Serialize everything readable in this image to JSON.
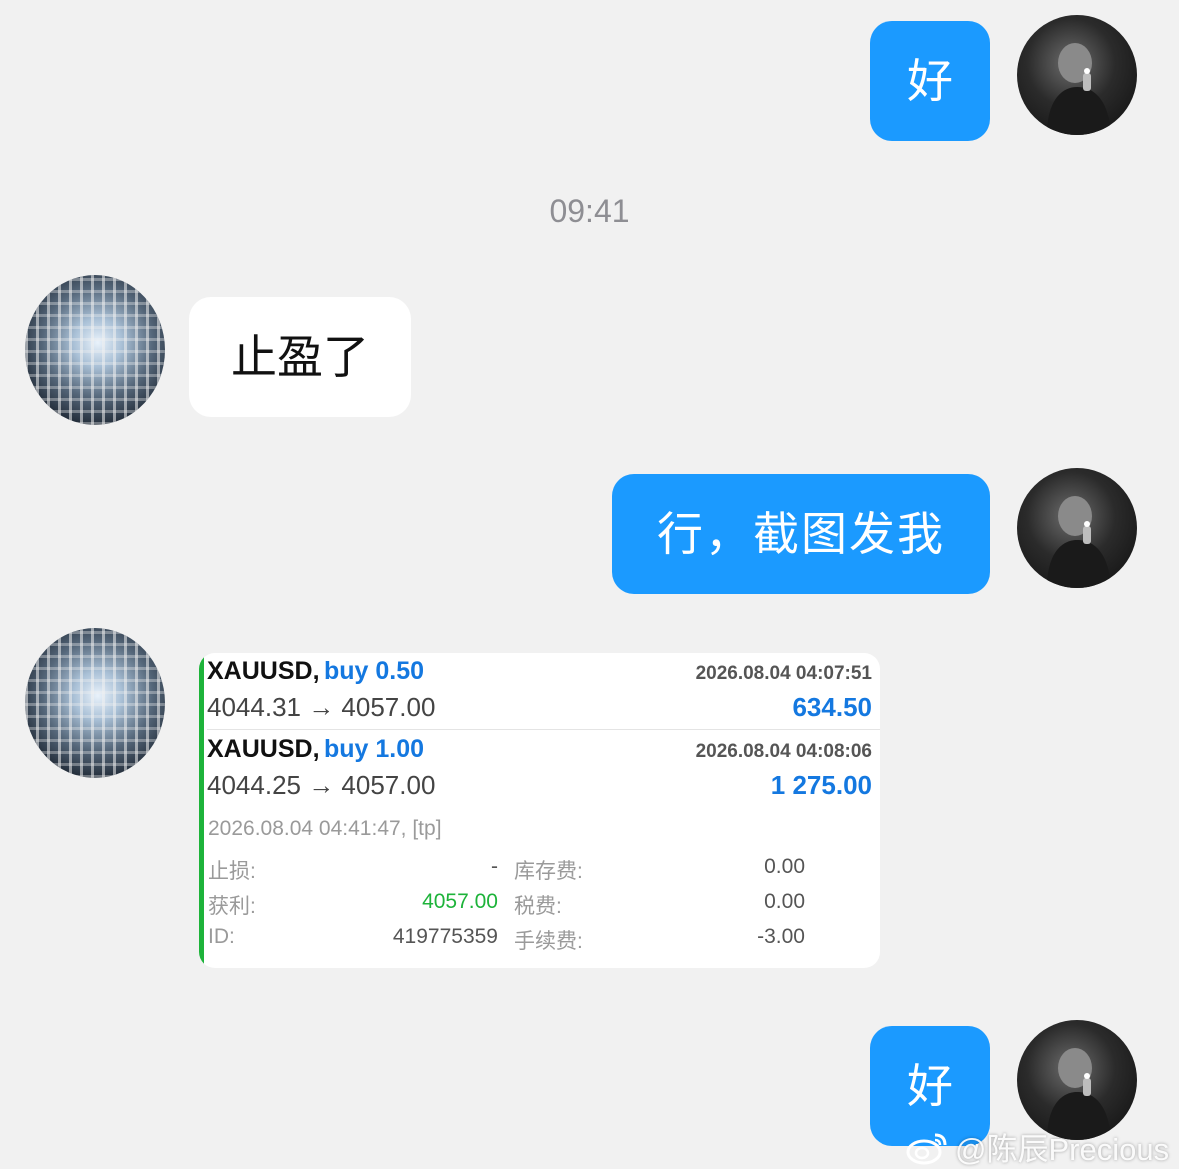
{
  "chat": {
    "msg1": "好",
    "time": "09:41",
    "msg2": "止盈了",
    "msg3": "行，截图发我",
    "msg4": "好"
  },
  "trade": {
    "deal1": {
      "symbol": "XAUUSD,",
      "side": "buy 0.50",
      "datetime": "2026.08.04 04:07:51",
      "prices": "4044.31 → 4057.00",
      "profit": "634.50"
    },
    "deal2": {
      "symbol": "XAUUSD,",
      "side": "buy 1.00",
      "datetime": "2026.08.04 04:08:06",
      "prices": "4044.25 → 4057.00",
      "profit": "1 275.00"
    },
    "closed": "2026.08.04 04:41:47, [tp]",
    "details": {
      "sl_label": "止损:",
      "sl_value": "-",
      "swap_label": "库存费:",
      "swap_value": "0.00",
      "tp_label": "获利:",
      "tp_value": "4057.00",
      "tax_label": "税费:",
      "tax_value": "0.00",
      "id_label": "ID:",
      "id_value": "419775359",
      "fee_label": "手续费:",
      "fee_value": "-3.00"
    }
  },
  "colors": {
    "outgoing_bubble": "#1b9aff",
    "buy_blue": "#1478e0",
    "tp_green": "#1db33a",
    "background": "#f1f1f1"
  },
  "watermark": {
    "icon": "weibo-icon",
    "text": "@陈辰Precious"
  }
}
